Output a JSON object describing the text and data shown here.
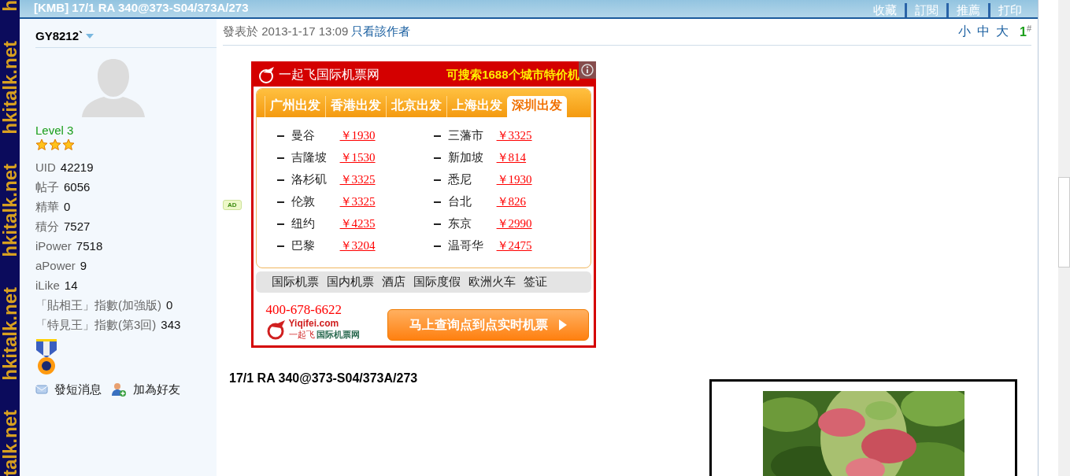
{
  "side_strip": [
    "h",
    "hkitalk.net",
    "hkitalk.net",
    "hkitalk.net",
    "talk.net"
  ],
  "header": {
    "title": "[KMB] 17/1 RA 340@373-S04/373A/273",
    "links": [
      "收藏",
      "訂閱",
      "推薦",
      "打印"
    ]
  },
  "author": {
    "name": "GY8212`",
    "level": "Level 3",
    "stars": 3,
    "stats": [
      {
        "label": "UID",
        "value": "42219"
      },
      {
        "label": "帖子",
        "value": "6056"
      },
      {
        "label": "精華",
        "value": "0"
      },
      {
        "label": "積分",
        "value": "7527"
      },
      {
        "label": "iPower",
        "value": "7518"
      },
      {
        "label": "aPower",
        "value": "9"
      },
      {
        "label": "iLike",
        "value": "14"
      },
      {
        "label": "「貼相王」指數(加強版)",
        "value": "0"
      },
      {
        "label": "「特見王」指數(第3回)",
        "value": "343"
      }
    ],
    "actions": [
      {
        "kind": "message",
        "label": "發短消息"
      },
      {
        "kind": "friend",
        "label": "加為好友"
      }
    ]
  },
  "post": {
    "posted": "發表於 2013-1-17 13:09",
    "author_only": "只看該作者",
    "font_sizes": [
      "小",
      "中",
      "大"
    ],
    "floor": "1",
    "floor_mark": "#",
    "ad_tag": "AD",
    "ad": {
      "brand": "一起飞国际机票网",
      "slogan": "可搜索1688个城市特价机",
      "tabs": [
        {
          "label": "广州出发",
          "selected": false
        },
        {
          "label": "香港出发",
          "selected": false
        },
        {
          "label": "北京出发",
          "selected": false
        },
        {
          "label": "上海出发",
          "selected": false
        },
        {
          "label": "深圳出发",
          "selected": true
        }
      ],
      "fares": [
        {
          "city": "曼谷",
          "price": "￥1930"
        },
        {
          "city": "三藩市",
          "price": "￥3325"
        },
        {
          "city": "吉隆坡",
          "price": "￥1530"
        },
        {
          "city": "新加坡",
          "price": "￥814"
        },
        {
          "city": "洛杉矶",
          "price": "￥3325"
        },
        {
          "city": "悉尼",
          "price": "￥1930"
        },
        {
          "city": "伦敦",
          "price": "￥3325"
        },
        {
          "city": "台北",
          "price": "￥826"
        },
        {
          "city": "纽约",
          "price": "￥4235"
        },
        {
          "city": "东京",
          "price": "￥2990"
        },
        {
          "city": "巴黎",
          "price": "￥3204"
        },
        {
          "city": "温哥华",
          "price": "￥2475"
        }
      ],
      "nav": [
        "国际机票",
        "国内机票",
        "酒店",
        "国际度假",
        "欧洲火车",
        "签证"
      ],
      "phone": "400-678-6622",
      "logo_site": "Yiqifei.com",
      "logo_name": "一起飞",
      "logo_sub": "国际机票网",
      "button": "马上查询点到点实时机票"
    },
    "title": "17/1 RA 340@373-S04/373A/273",
    "image": {
      "kind": "picture"
    }
  }
}
